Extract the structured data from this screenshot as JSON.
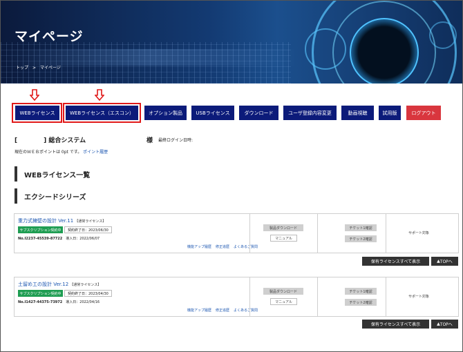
{
  "header": {
    "title": "マイページ",
    "breadcrumb": [
      "トップ",
      ">",
      "マイページ"
    ]
  },
  "nav": {
    "items": [
      "WEBライセンス",
      "WEBライセンス（エスコン）",
      "オプション製品",
      "USBライセンス",
      "ダウンロード",
      "ユーザ登録内容変更",
      "動画視聴",
      "試用版",
      "ログアウト"
    ]
  },
  "account": {
    "system_open": "[",
    "system_name": "] 総合システム",
    "sama": "様",
    "last_login": "最終ログイン日時:",
    "points_text": "現在のＷＥＢポイントは 0pt です。",
    "points_link": "ポイント履歴"
  },
  "sections": {
    "web_license": "WEBライセンス一覧",
    "exceed": "エクシードシリーズ"
  },
  "products": [
    {
      "name": "重力式擁壁の設計 Ver.11",
      "type": "【通常ライセンス】",
      "badge": "サブスクリプション契約中",
      "contract_end": "契約終了日：2023/06/30",
      "serial": "No.I2237-45539-87722",
      "install": "導入日：2022/06/07",
      "links": [
        "機能アップ履歴",
        "修正追歴",
        "よくあるご質問"
      ],
      "download": "製品ダウンロード",
      "manual": "マニュアル",
      "ticket1": "チケット1確認",
      "ticket2": "チケット2確認",
      "support": "サポート対象"
    },
    {
      "name": "土留め工の設計 Ver.12",
      "type": "【通常ライセンス】",
      "badge": "サブスクリプション契約中",
      "contract_end": "契約終了日：2023/04/30",
      "serial": "No.I1427-44375-73972",
      "install": "導入日：2022/04/16",
      "links": [
        "機能アップ履歴",
        "修正追歴",
        "よくあるご質問"
      ],
      "download": "製品ダウンロード",
      "manual": "マニュアル",
      "ticket1": "チケット1確認",
      "ticket2": "チケット2確認",
      "support": "サポート対象"
    }
  ],
  "actions": {
    "show_all": "保有ライセンスすべて表示",
    "top": "TOPへ"
  },
  "colors": {
    "nav": "#0c1b7a",
    "logout": "#d9363e",
    "badge": "#1e9d52",
    "highlight": "#e01919"
  }
}
